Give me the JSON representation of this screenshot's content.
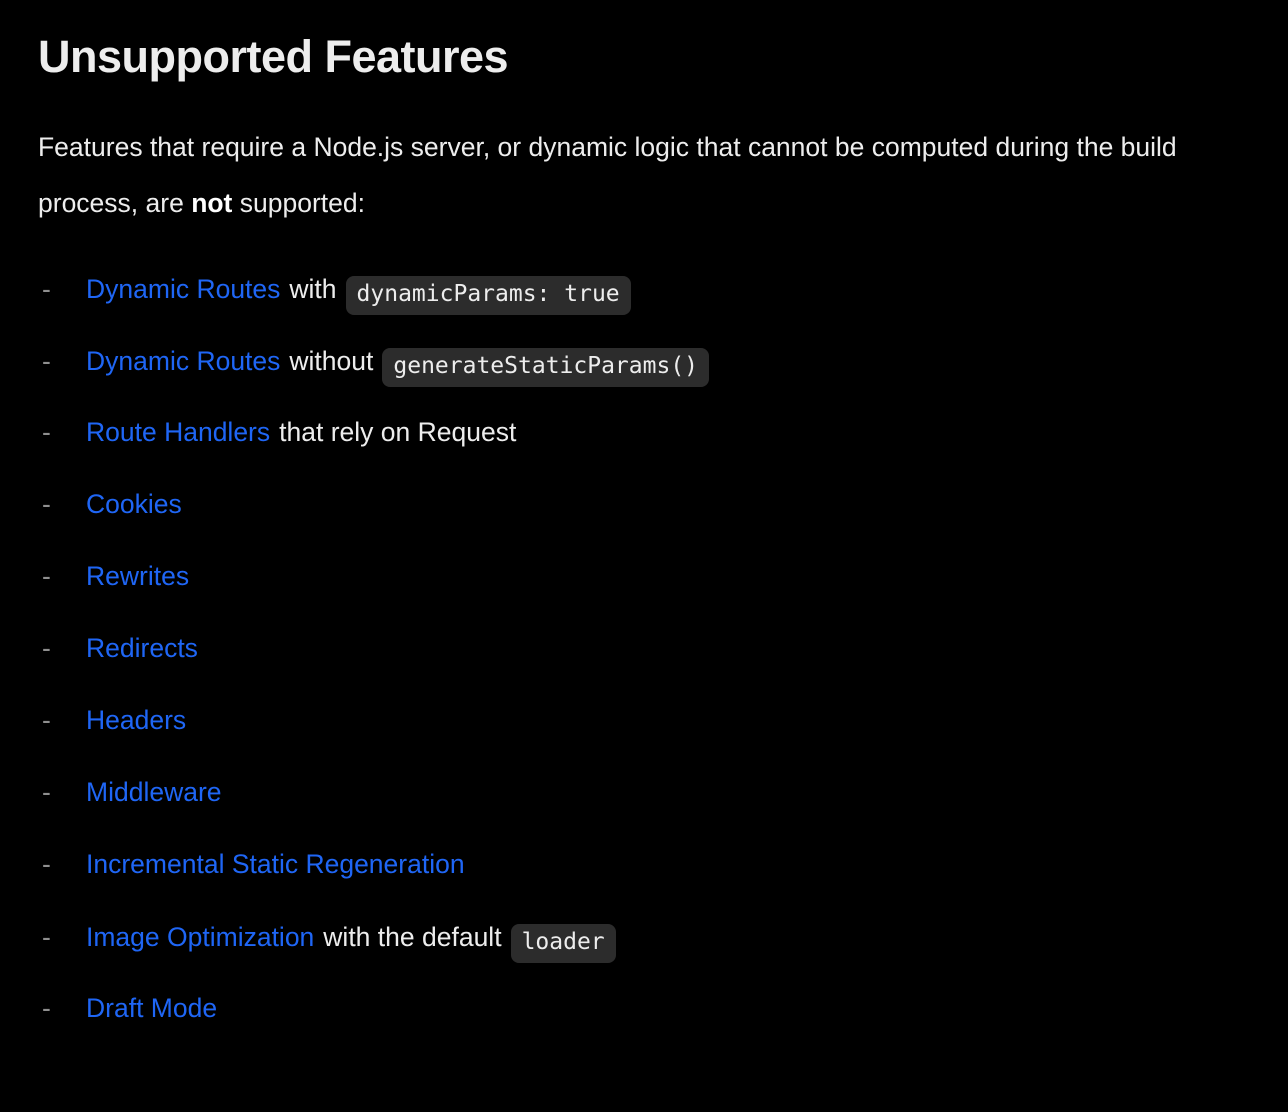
{
  "page": {
    "title": "Unsupported Features",
    "background_color": "#000000",
    "text_color": "#ededed",
    "link_color": "#1f66f5",
    "code_background_color": "#2c2c2c",
    "bullet_color": "#8f8f8f"
  },
  "intro": {
    "part1": "Features that require a Node.js server, or dynamic logic that cannot be computed during the build process, are ",
    "emphasis": "not",
    "part2": " supported:"
  },
  "bullet_marker": "-",
  "items": [
    {
      "link": "Dynamic Routes",
      "middle": "with",
      "code": "dynamicParams: true",
      "trailing": ""
    },
    {
      "link": "Dynamic Routes",
      "middle": "without",
      "code": "generateStaticParams()",
      "trailing": ""
    },
    {
      "link": "Route Handlers",
      "middle": "that rely on Request",
      "code": "",
      "trailing": ""
    },
    {
      "link": "Cookies",
      "middle": "",
      "code": "",
      "trailing": ""
    },
    {
      "link": "Rewrites",
      "middle": "",
      "code": "",
      "trailing": ""
    },
    {
      "link": "Redirects",
      "middle": "",
      "code": "",
      "trailing": ""
    },
    {
      "link": "Headers",
      "middle": "",
      "code": "",
      "trailing": ""
    },
    {
      "link": "Middleware",
      "middle": "",
      "code": "",
      "trailing": ""
    },
    {
      "link": "Incremental Static Regeneration",
      "middle": "",
      "code": "",
      "trailing": ""
    },
    {
      "link": "Image Optimization",
      "middle": "with the default",
      "code": "loader",
      "trailing": ""
    },
    {
      "link": "Draft Mode",
      "middle": "",
      "code": "",
      "trailing": ""
    }
  ]
}
